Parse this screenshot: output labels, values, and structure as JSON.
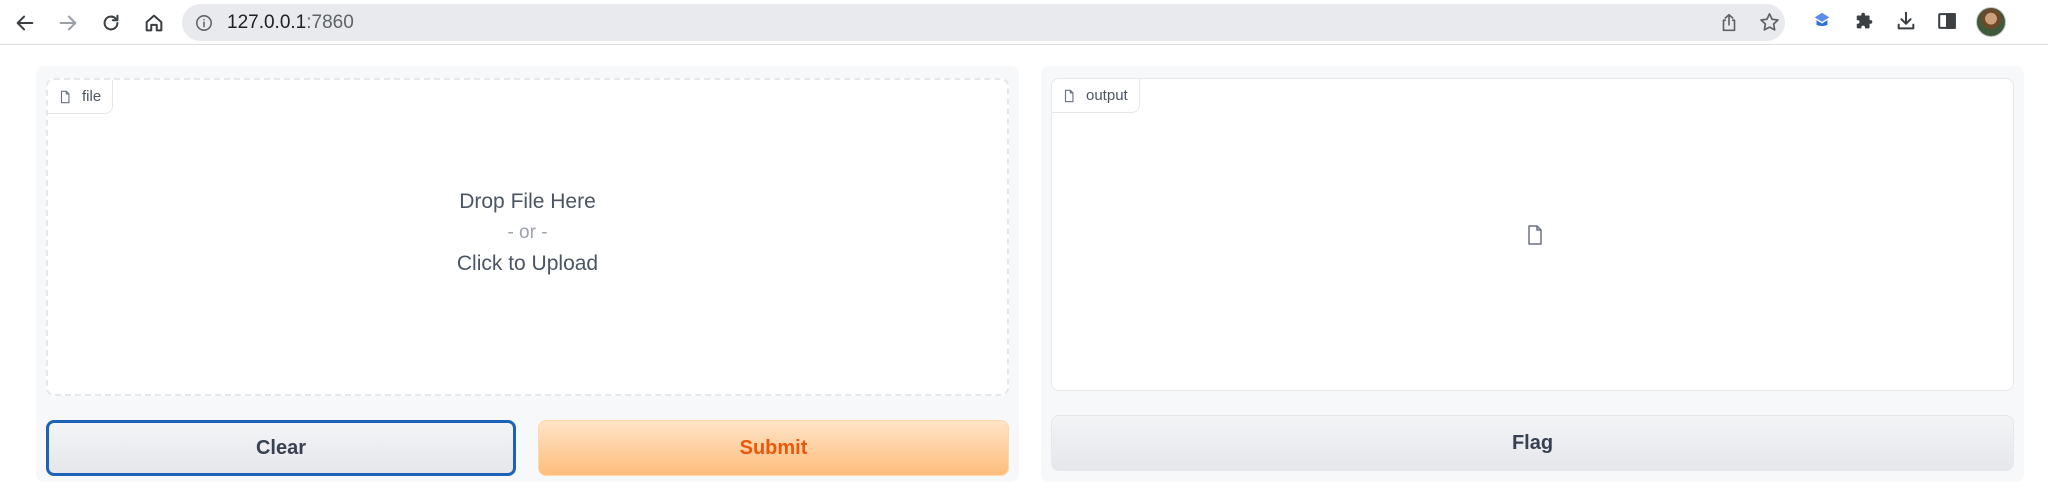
{
  "browser": {
    "url_host": "127.0.0.1",
    "url_port": ":7860",
    "icons": {
      "back": "arrow-left-icon",
      "forward": "arrow-right-icon",
      "reload": "reload-icon",
      "home": "home-icon",
      "info": "info-icon",
      "share": "share-icon",
      "bookmark": "star-icon",
      "extension": "extension-icon",
      "extensions_menu": "puzzle-icon",
      "downloads": "download-icon",
      "side_panel": "side-panel-icon",
      "profile": "avatar"
    }
  },
  "input_panel": {
    "label": "file",
    "drop_text": "Drop File Here",
    "or_text": "- or -",
    "upload_text": "Click to Upload",
    "clear_label": "Clear",
    "submit_label": "Submit"
  },
  "output_panel": {
    "label": "output",
    "flag_label": "Flag"
  },
  "colors": {
    "submit_text": "#ea580c",
    "submit_bg": "#fdbd7c",
    "clear_border": "#1d62b4",
    "panel_bg": "#f7f8fa"
  }
}
